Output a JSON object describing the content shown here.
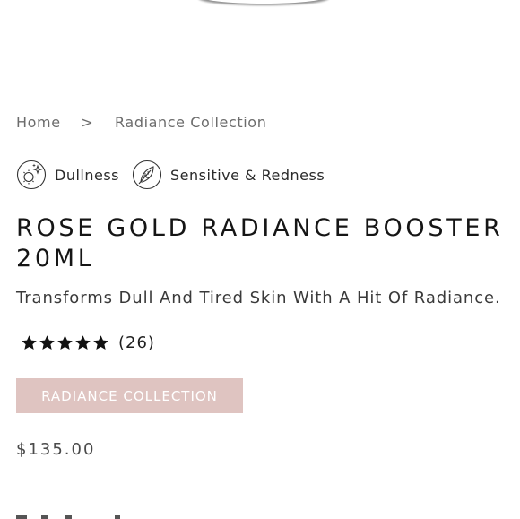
{
  "breadcrumb": {
    "home": "Home",
    "separator": ">",
    "current": "Radiance Collection"
  },
  "concerns": [
    {
      "label": "Dullness",
      "icon": "radiance-face-icon"
    },
    {
      "label": "Sensitive & Redness",
      "icon": "feather-leaf-icon"
    }
  ],
  "product": {
    "title": "Rose Gold Radiance Booster 20ml",
    "subtitle": "Transforms Dull And Tired Skin With A Hit Of Radiance.",
    "rating": {
      "stars": 5,
      "max_stars": 5,
      "review_count": "(26)"
    },
    "collection_button": "Radiance Collection",
    "price": "$135.00"
  },
  "colors": {
    "collection_button_bg": "#dfc4c1",
    "text": "#1f1f1f"
  }
}
